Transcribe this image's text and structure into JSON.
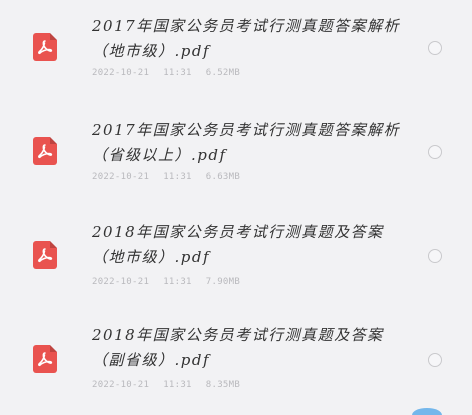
{
  "files": [
    {
      "name": "2017年国家公务员考试行测真题答案解析（地市级）.pdf",
      "date": "2022-10-21",
      "time": "11:31",
      "size": "6.52MB",
      "icon": "pdf-file-icon"
    },
    {
      "name": "2017年国家公务员考试行测真题答案解析（省级以上）.pdf",
      "date": "2022-10-21",
      "time": "11:31",
      "size": "6.63MB",
      "icon": "pdf-file-icon"
    },
    {
      "name": "2018年国家公务员考试行测真题及答案（地市级）.pdf",
      "date": "2022-10-21",
      "time": "11:31",
      "size": "7.90MB",
      "icon": "pdf-file-icon"
    },
    {
      "name": "2018年国家公务员考试行测真题及答案（副省级）.pdf",
      "date": "2022-10-21",
      "time": "11:31",
      "size": "8.35MB",
      "icon": "pdf-file-icon"
    }
  ],
  "colors": {
    "pdf_icon": "#e9534f",
    "background": "#f2f2f4",
    "text": "#333333",
    "meta": "#b9b9bd"
  }
}
